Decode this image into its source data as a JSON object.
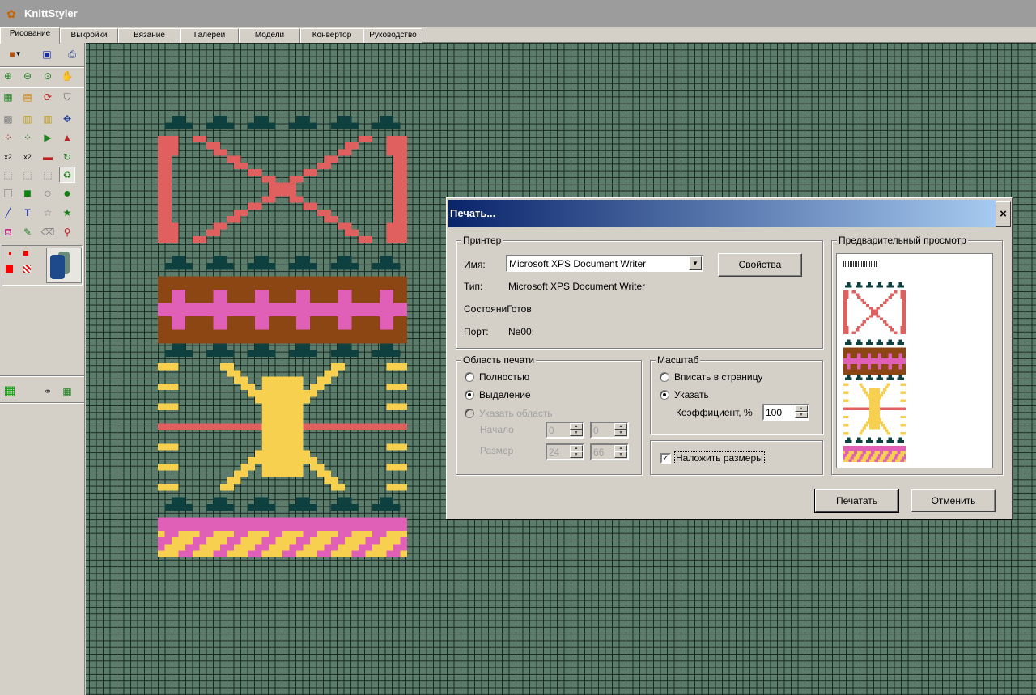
{
  "window": {
    "title": "KnittStyler",
    "app_icon": "butterfly-icon"
  },
  "tabs": [
    {
      "label": "Рисование",
      "active": true
    },
    {
      "label": "Выкройки"
    },
    {
      "label": "Вязание"
    },
    {
      "label": "Галереи"
    },
    {
      "label": "Модели"
    },
    {
      "label": "Конвертор"
    },
    {
      "label": "Руководство"
    }
  ],
  "toolbox": {
    "tools": [
      "open-menu-icon",
      "save-icon",
      "print-icon",
      "zoom-in-icon",
      "zoom-out-icon",
      "zoom-fit-icon",
      "hand-pan-icon",
      "grid-icon",
      "color-grid-icon",
      "rotate-icon",
      "shield-icon",
      "dotted-grid-icon",
      "fill-pattern-icon",
      "fill-pattern2-icon",
      "move-icon",
      "flip-h-icon",
      "flip-v-icon",
      "triangle-right-icon",
      "triangle-up-icon",
      "scale2-icon",
      "scale2-alt-icon",
      "stretch-icon",
      "refresh-icon",
      "select-rect-icon",
      "select-lasso-icon",
      "select-magic-icon",
      "recycle-icon",
      "rect-empty-icon",
      "rect-filled-icon",
      "ellipse-empty-icon",
      "ellipse-filled-icon",
      "line-icon",
      "text-icon",
      "star-empty-icon",
      "star-filled-icon",
      "fill-bucket-icon",
      "brush-icon",
      "eraser-icon",
      "eyedropper-icon",
      "small-dot-icon",
      "large-dot-icon",
      "checker-icon",
      "yarn-icon",
      "color-grid-green-icon",
      "binoculars-icon",
      "calculator-icon"
    ],
    "colors": {
      "red": "#ff0000",
      "yarn_blue": "#1e4a8c",
      "yarn_green": "#6a8a7a"
    }
  },
  "canvas": {
    "background": "#5c7c6c",
    "grid_color": "#1a2a22",
    "palette": {
      "dark": "#0e4040",
      "salmon": "#e06060",
      "brown": "#8c4614",
      "pink": "#e060b8",
      "yellow": "#f8d050"
    }
  },
  "dialog": {
    "title": "Печать...",
    "close_label": "×",
    "printer_group": "Принтер",
    "name_label": "Имя:",
    "printer_name": "Microsoft XPS Document Writer",
    "properties_button": "Свойства",
    "type_label": "Тип:",
    "type_value": "Microsoft XPS Document Writer",
    "status_text": "СостояниГотов",
    "port_label": "Порт:",
    "port_value": "Ne00:",
    "print_area_group": "Область печати",
    "opt_full": "Полностью",
    "opt_selection": "Выделение",
    "opt_area": "Указать область",
    "start_label": "Начало",
    "size_label": "Размер",
    "start_x": "0",
    "start_y": "0",
    "size_w": "24",
    "size_h": "66",
    "scale_group": "Масштаб",
    "opt_fit": "Вписать в страницу",
    "opt_specify": "Указать",
    "coef_label": "Коэффициент, %",
    "coef_value": "100",
    "overlay_sizes": "Наложить размеры",
    "overlay_checked": true,
    "preview_group": "Предварительный просмотр",
    "print_button": "Печатать",
    "cancel_button": "Отменить"
  }
}
